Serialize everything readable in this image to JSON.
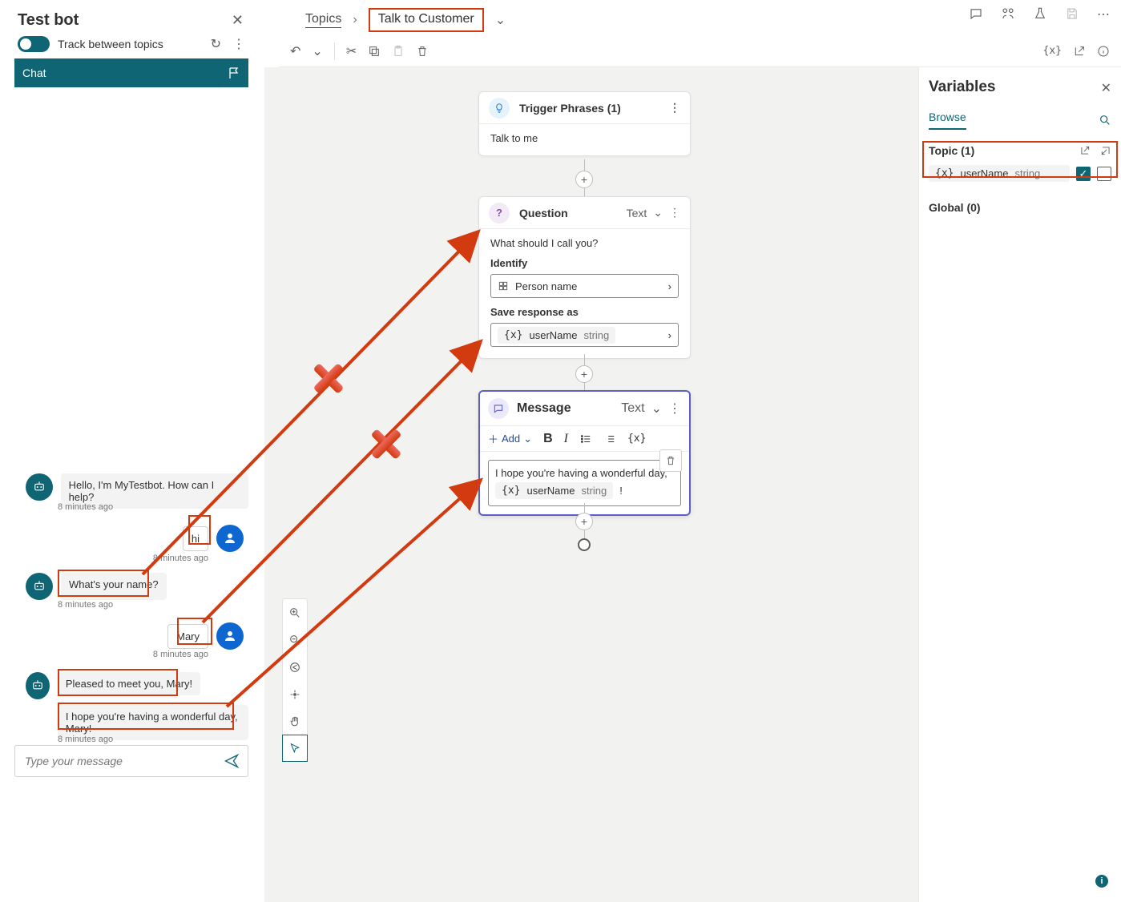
{
  "testbot": {
    "title": "Test bot",
    "track_label": "Track between topics",
    "chat_label": "Chat",
    "messages": {
      "m1": "Hello, I'm MyTestbot. How can I help?",
      "m2": "hi",
      "m3": "What's your name?",
      "m4": "Mary",
      "m5": "Pleased to meet you, Mary!",
      "m6": "I hope you're having a wonderful day, Mary!"
    },
    "timestamps": {
      "t1": "8 minutes ago",
      "t2": "8 minutes ago",
      "t3": "8 minutes ago",
      "t4": "8 minutes ago",
      "t5": "8 minutes ago"
    },
    "input_placeholder": "Type your message"
  },
  "breadcrumb": {
    "root": "Topics",
    "current": "Talk to Customer"
  },
  "flow": {
    "trigger": {
      "title": "Trigger Phrases (1)",
      "phrase": "Talk to me"
    },
    "question": {
      "title": "Question",
      "type_label": "Text",
      "prompt": "What should I call you?",
      "identify_label": "Identify",
      "identify_value": "Person name",
      "save_label": "Save response as",
      "var_name": "userName",
      "var_type": "string"
    },
    "message": {
      "title": "Message",
      "type_label": "Text",
      "add_label": "Add",
      "body": "I hope you're having a wonderful day,",
      "punct": "!",
      "var_name": "userName",
      "var_type": "string"
    }
  },
  "variables": {
    "title": "Variables",
    "tab": "Browse",
    "topic_label": "Topic (1)",
    "global_label": "Global (0)",
    "var_name": "userName",
    "var_type": "string"
  }
}
